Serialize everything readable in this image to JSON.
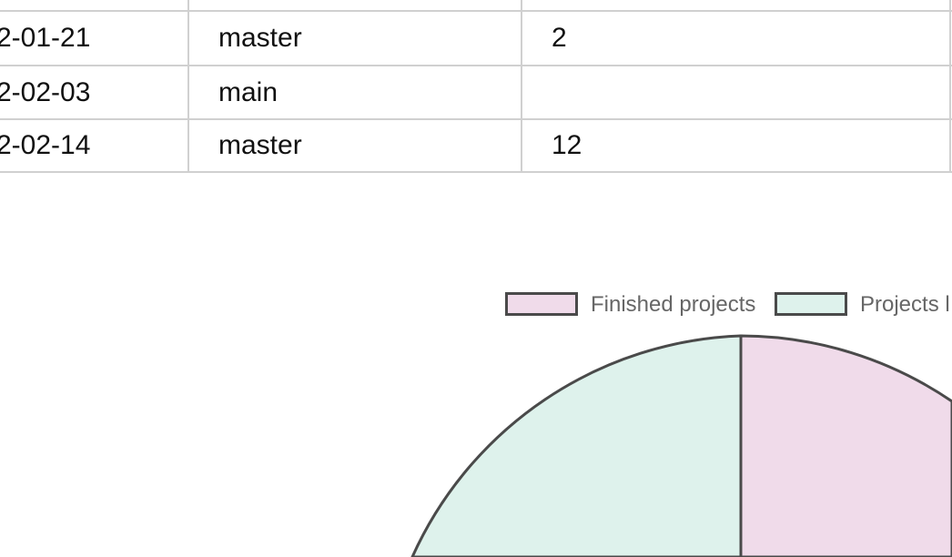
{
  "table": {
    "rows": [
      {
        "date": "2-01-21",
        "branch": "master",
        "count": "2"
      },
      {
        "date": "2-02-03",
        "branch": "main",
        "count": ""
      },
      {
        "date": "2-02-14",
        "branch": "master",
        "count": "12"
      }
    ]
  },
  "chart_data": {
    "type": "pie",
    "legend": [
      {
        "label": "Finished projects",
        "color": "#f0dbea"
      },
      {
        "label": "Projects l",
        "color": "#def2ec"
      }
    ],
    "series": [
      {
        "name": "Finished projects",
        "color": "#f0dbea"
      },
      {
        "name": "Projects l",
        "color": "#def2ec"
      }
    ],
    "border_color": "#4a4a4a",
    "legend_position": "top"
  }
}
